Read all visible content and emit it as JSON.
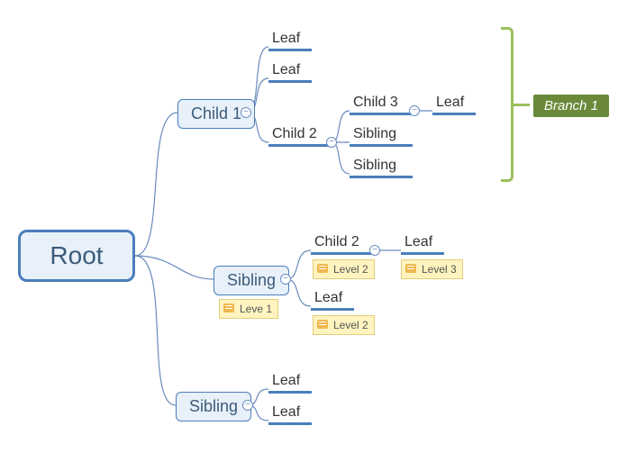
{
  "root": {
    "label": "Root"
  },
  "child1": {
    "label": "Child 1"
  },
  "sibling_mid": {
    "label": "Sibling"
  },
  "sibling_bot": {
    "label": "Sibling"
  },
  "c1_leaf1": "Leaf",
  "c1_leaf2": "Leaf",
  "c1_child2": "Child 2",
  "c2_child3": "Child 3",
  "c3_leaf": "Leaf",
  "c2_sib1": "Sibling",
  "c2_sib2": "Sibling",
  "mid_child2": "Child 2",
  "mid_child2_leaf": "Leaf",
  "mid_leaf": "Leaf",
  "bot_leaf1": "Leaf",
  "bot_leaf2": "Leaf",
  "note_level1": "Leve 1",
  "note_level2a": "Level 2",
  "note_level2b": "Level 2",
  "note_level3": "Level 3",
  "branch_badge": "Branch 1",
  "chart_data": {
    "type": "tree",
    "root": {
      "label": "Root",
      "children": [
        {
          "label": "Child 1",
          "annotation": "Branch 1",
          "children": [
            {
              "label": "Leaf"
            },
            {
              "label": "Leaf"
            },
            {
              "label": "Child 2",
              "children": [
                {
                  "label": "Child 3",
                  "children": [
                    {
                      "label": "Leaf"
                    }
                  ]
                },
                {
                  "label": "Sibling"
                },
                {
                  "label": "Sibling"
                }
              ]
            }
          ]
        },
        {
          "label": "Sibling",
          "note": "Leve 1",
          "children": [
            {
              "label": "Child 2",
              "note": "Level 2",
              "children": [
                {
                  "label": "Leaf",
                  "note": "Level 3"
                }
              ]
            },
            {
              "label": "Leaf",
              "note": "Level 2"
            }
          ]
        },
        {
          "label": "Sibling",
          "children": [
            {
              "label": "Leaf"
            },
            {
              "label": "Leaf"
            }
          ]
        }
      ]
    }
  }
}
